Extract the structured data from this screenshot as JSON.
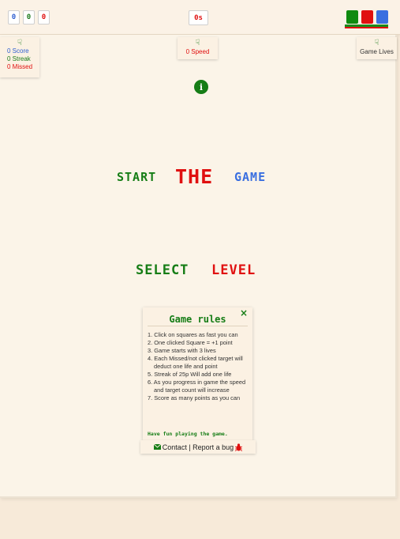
{
  "topbar": {
    "counters": [
      "0",
      "0",
      "0"
    ],
    "timer": "0s"
  },
  "stats": {
    "score": "0 Score",
    "streak": "0 Streak",
    "missed": "0 Missed",
    "speed": "0 Speed",
    "lives_label": "Game Lives"
  },
  "colors": {
    "score": "#2f5fd0",
    "streak": "#1b7a1b",
    "missed": "#e01010",
    "life_green": "#0f8a0f",
    "life_red": "#e01010",
    "life_blue": "#3a6fe0"
  },
  "icons": {
    "pointer": "hand-pointer-down",
    "info": "info-circle",
    "envelope": "envelope",
    "bug": "bug"
  },
  "game": {
    "start": {
      "word1": "START",
      "word2": "THE",
      "word3": "GAME"
    },
    "select": {
      "word1": "SELECT",
      "word2": "LEVEL"
    }
  },
  "rules": {
    "title": "Game rules",
    "close": "×",
    "items": [
      "1. Click on squares as fast you can",
      "2. One clicked Square = +1 point",
      "3. Game starts with 3 lives",
      "4. Each Missed/not clicked target will deduct one life and point",
      "5. Streak of 25p Will add one life",
      "6. As you progress in game the speed and target count will increase",
      "7. Score as many points as you can"
    ],
    "footer": "Have fun playing the game."
  },
  "contact": {
    "label": "Contact | Report a bug"
  }
}
